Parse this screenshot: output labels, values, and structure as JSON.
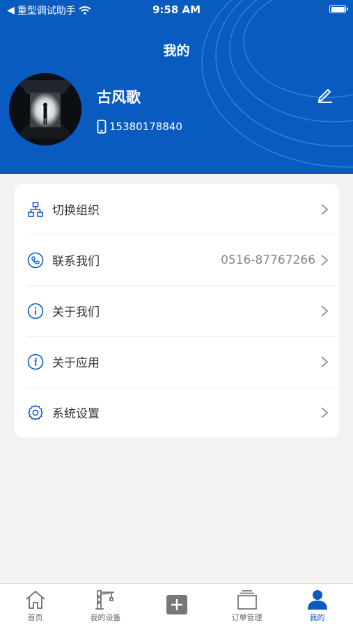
{
  "status": {
    "carrier": "重型调试助手",
    "time": "9:58 AM"
  },
  "header": {
    "title": "我的"
  },
  "profile": {
    "name": "古风歌",
    "phone": "15380178840"
  },
  "menu": [
    {
      "label": "切换组织",
      "icon": "org-icon"
    },
    {
      "label": "联系我们",
      "value": "0516-87767266",
      "icon": "phone-icon"
    },
    {
      "label": "关于我们",
      "icon": "info-icon"
    },
    {
      "label": "关于应用",
      "icon": "info-icon"
    },
    {
      "label": "系统设置",
      "icon": "gear-icon"
    }
  ],
  "tabs": [
    {
      "label": "首页",
      "icon": "home-icon"
    },
    {
      "label": "我的设备",
      "icon": "crane-icon"
    },
    {
      "label": "",
      "icon": "add-icon"
    },
    {
      "label": "订单管理",
      "icon": "orders-icon"
    },
    {
      "label": "我的",
      "icon": "user-icon"
    }
  ],
  "colors": {
    "primary": "#0a5bbf",
    "background": "#f2f2f2"
  }
}
